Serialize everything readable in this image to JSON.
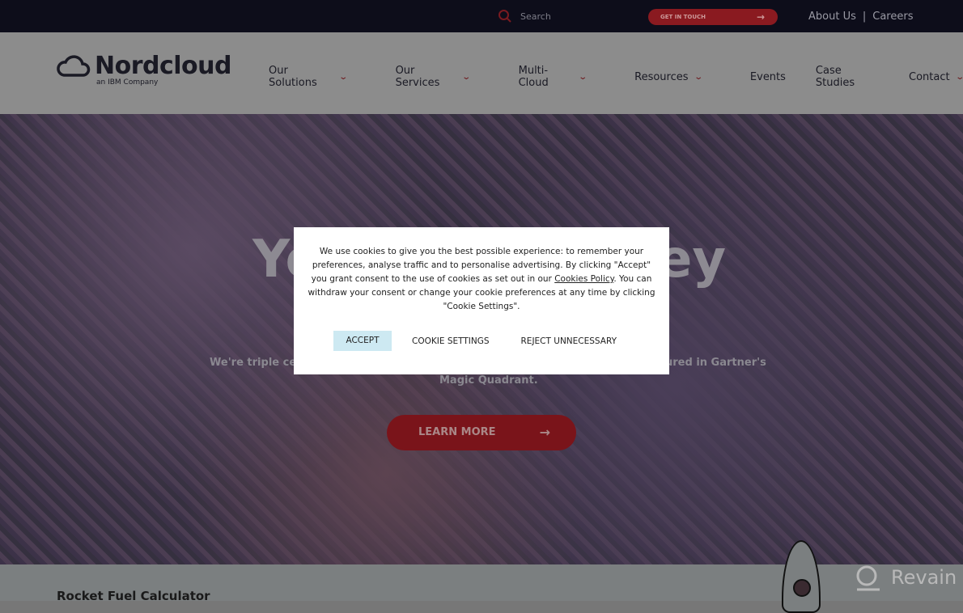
{
  "topbar": {
    "search_placeholder": "Search",
    "get_in_touch": "GET IN TOUCH",
    "links": [
      "About Us",
      "Careers"
    ],
    "separator": "|"
  },
  "logo": {
    "name": "Nordcloud",
    "tagline": "an IBM Company"
  },
  "nav": {
    "items": [
      {
        "label": "Our Solutions",
        "dropdown": true
      },
      {
        "label": "Our Services",
        "dropdown": true
      },
      {
        "label": "Multi-Cloud",
        "dropdown": true
      },
      {
        "label": "Resources",
        "dropdown": true
      },
      {
        "label": "Events",
        "dropdown": false
      },
      {
        "label": "Case Studies",
        "dropdown": false
      },
      {
        "label": "Contact",
        "dropdown": true
      }
    ]
  },
  "hero": {
    "headline_left": "Yo",
    "headline_right": "ey",
    "subtitle_left": "We're triple certi",
    "subtitle_right": "ured in Gartner's",
    "subtitle_line2": "Magic Quadrant.",
    "cta": "LEARN MORE"
  },
  "bottom": {
    "title": "Rocket Fuel Calculator"
  },
  "watermark": "Revain",
  "cookie": {
    "text_before": "We use cookies to give you the best possible experience: to remember your preferences, analyse traffic and to personalise advertising. By clicking \"Accept\" you grant consent to the use of cookies as set out in our ",
    "link": "Cookies Policy",
    "text_after": ". You can withdraw your consent or change your cookie preferences at any time by clicking \"Cookie Settings\".",
    "accept": "ACCEPT",
    "settings": "COOKIE SETTINGS",
    "reject": "REJECT UNNECESSARY"
  },
  "colors": {
    "brand_red": "#c4242c",
    "accept_bg": "#cde9f2",
    "topbar": "#0d0d1a"
  }
}
